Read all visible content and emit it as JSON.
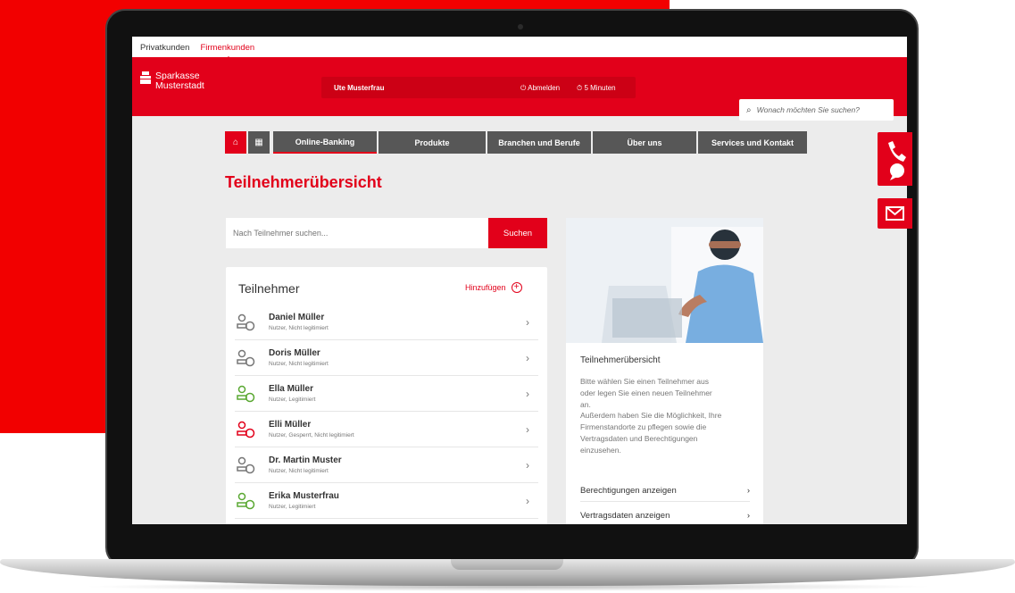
{
  "topbar": {
    "segments": [
      "Privatkunden",
      "Firmenkunden"
    ]
  },
  "header": {
    "logo_line1": "Sparkasse",
    "logo_line2": "Musterstadt",
    "user_name": "Ute Musterfrau",
    "logout": "Abmelden",
    "session_time": "5 Minuten",
    "search_placeholder": "Wonach möchten Sie suchen?"
  },
  "nav": {
    "items": [
      "Online-Banking",
      "Produkte",
      "Branchen und Berufe",
      "Über uns",
      "Services und Kontakt"
    ]
  },
  "page": {
    "title": "Teilnehmerübersicht",
    "member_search_placeholder": "Nach Teilnehmer suchen...",
    "search_button": "Suchen"
  },
  "members": {
    "title": "Teilnehmer",
    "add_label": "Hinzufügen",
    "items": [
      {
        "name": "Daniel Müller",
        "status": "Nutzer, Nicht legitimiert"
      },
      {
        "name": "Doris Müller",
        "status": "Nutzer, Nicht legitimiert"
      },
      {
        "name": "Ella Müller",
        "status": "Nutzer, Legitimiert"
      },
      {
        "name": "Elli Müller",
        "status": "Nutzer, Gesperrt, Nicht legitimiert"
      },
      {
        "name": "Dr. Martin Muster",
        "status": "Nutzer, Nicht legitimiert"
      },
      {
        "name": "Erika Musterfrau",
        "status": "Nutzer, Legitimiert"
      }
    ]
  },
  "info": {
    "title": "Teilnehmerübersicht",
    "text": "Bitte wählen Sie einen Teilnehmer aus\noder legen Sie einen neuen Teilnehmer\nan.\nAußerdem haben Sie die Möglichkeit, Ihre\nFirmenstandorte zu pflegen sowie die\nVertragsdaten und Berechtigungen\neinzusehen.",
    "links": [
      "Berechtigungen anzeigen",
      "Vertragsdaten anzeigen"
    ]
  },
  "colors": {
    "brand_red": "#e2001a",
    "nav_gray": "#575757",
    "legitimized_green": "#5aa832",
    "blocked_red": "#e2001a"
  }
}
